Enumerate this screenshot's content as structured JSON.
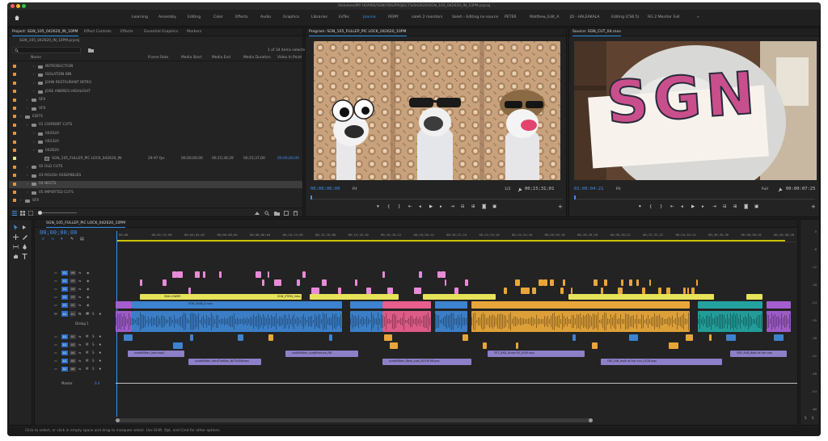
{
  "window": {
    "title": "/Volumes/MY HOARD/SGN/YDS/PROJECTS/042620/SGN_105_042620_IN_10PM.prproj"
  },
  "workspaces": [
    "Learning",
    "Assembly",
    "Editing",
    "Color",
    "Effects",
    "Audio",
    "Graphics",
    "Libraries",
    "EdTec",
    "Joanna",
    "REMY",
    "saleh 2 monitors",
    "Saleh - Editing no source",
    "PETER",
    "Matthew_Edit_A",
    "JD - HALEAKALA",
    "Editing (CS6.5)",
    "RG 2 Monitor Full"
  ],
  "workspaces_overflow": "»",
  "project_panel": {
    "tabs": [
      "Project: SGN_105_042620_IN_10PM",
      "Effect Controls",
      "Effects",
      "Essential Graphics",
      "Markers"
    ],
    "project_file": "SGN_105_042620_IN_10PM.prproj",
    "items_selected": "1 of 34 items selected",
    "columns": [
      "Name",
      "Frame Rate",
      "Media Start",
      "Media End",
      "Media Duration",
      "Video In Point"
    ],
    "rows": [
      {
        "name": "INTRODUCTION",
        "indent": 2
      },
      {
        "name": "ISOLATION BIN",
        "indent": 2
      },
      {
        "name": "JOHN RESTAURANT INTRO",
        "indent": 2
      },
      {
        "name": "JOSE ANDRES HIGHLIGHT",
        "indent": 2
      },
      {
        "name": "SFX",
        "indent": 1
      },
      {
        "name": "VFX",
        "indent": 1
      },
      {
        "name": "EDITS",
        "indent": 0
      },
      {
        "name": "01 CURRENT CUTS",
        "indent": 1
      },
      {
        "name": "042020",
        "indent": 2
      },
      {
        "name": "042320",
        "indent": 2
      },
      {
        "name": "042620",
        "indent": 2
      },
      {
        "name": "SGN_105_FULLEP_PIC LOCK_042620_IN",
        "indent": 3,
        "frame_rate": "29.97 fps",
        "media_start": "00;00;00;00",
        "media_end": "00;15;36;29",
        "media_duration": "00;15;37;00",
        "video_in": "00;00;00;00"
      },
      {
        "name": "02 OLD CUTS",
        "indent": 1
      },
      {
        "name": "03 ROUGH ASSEMBLIES",
        "indent": 1
      },
      {
        "name": "04 NESTS",
        "indent": 1
      },
      {
        "name": "05 IMPORTED CUTS",
        "indent": 1
      },
      {
        "name": "SFX",
        "indent": 0
      }
    ]
  },
  "program_monitor": {
    "title": "Program: SGN_105_FULLEP_PIC LOCK_042620_10PM",
    "timecode": "00;00;00;00",
    "fit": "Fit",
    "resolution": "1/2",
    "duration": "00;15;31;01"
  },
  "source_monitor": {
    "title": "Source: SGN_CUT_04.mov",
    "timecode": "01:00:04:21",
    "fit": "Fit",
    "resolution": "Full",
    "duration": "00:00:07:25",
    "sign_text": "SGN"
  },
  "timeline": {
    "tab": "SGN_105_FULLEP_PIC LOCK_042620_10PM",
    "timecode": "00;00;00;00",
    "ruler": [
      "00;00",
      "00;02;32;00",
      "00;04;04;02",
      "00;06;08;04",
      "00;08;00;04",
      "00;10;12;06",
      "00;12;16;08",
      "00;14;16;10",
      "00;16;18;12",
      "00;18;20;14",
      "00;20;22;14",
      "00;22;24;16",
      "00;24;24;18",
      "00;26;26;18",
      "00;28;28;20",
      "00;30;30;22",
      "00;32;32;22",
      "00;34;34;24",
      "00;36;36;26",
      "00;38;38;26",
      "00;40;40;28"
    ],
    "video_tracks": [
      "V6",
      "V5",
      "V4",
      "V3",
      "V2",
      "V1"
    ],
    "audio_tracks": [
      "A1",
      "A2",
      "A3",
      "A4",
      "A5",
      "A6"
    ],
    "dialog_label": "Dialog 1",
    "master": "Master",
    "master_value": "0.0",
    "clip_names": [
      "SNA LOWER",
      "SGN_STEIN_Intro_B",
      "SGN_0088_E.mov",
      "scottWilber_intro.mp4",
      "scottWilber_IntroTheMon_NOTHOW.wav",
      "scottWilber_LongProduce_RB",
      "scottWilber_Rose_Lost_NOTHOW.wav",
      "TET_SAD_Drum Fill_0150.wav",
      "GW_SnB_walk at the rum_0128.wav",
      "SSR_SnB_Walk at the com"
    ]
  },
  "meters": [
    "0",
    "-6",
    "-12",
    "-18",
    "-24",
    "-30",
    "-36",
    "-42",
    "-48",
    "-54",
    "dB"
  ],
  "status_bar": "Click to select, or click in empty space and drag to marquee select. Use Shift, Opt, and Cmd for other options."
}
